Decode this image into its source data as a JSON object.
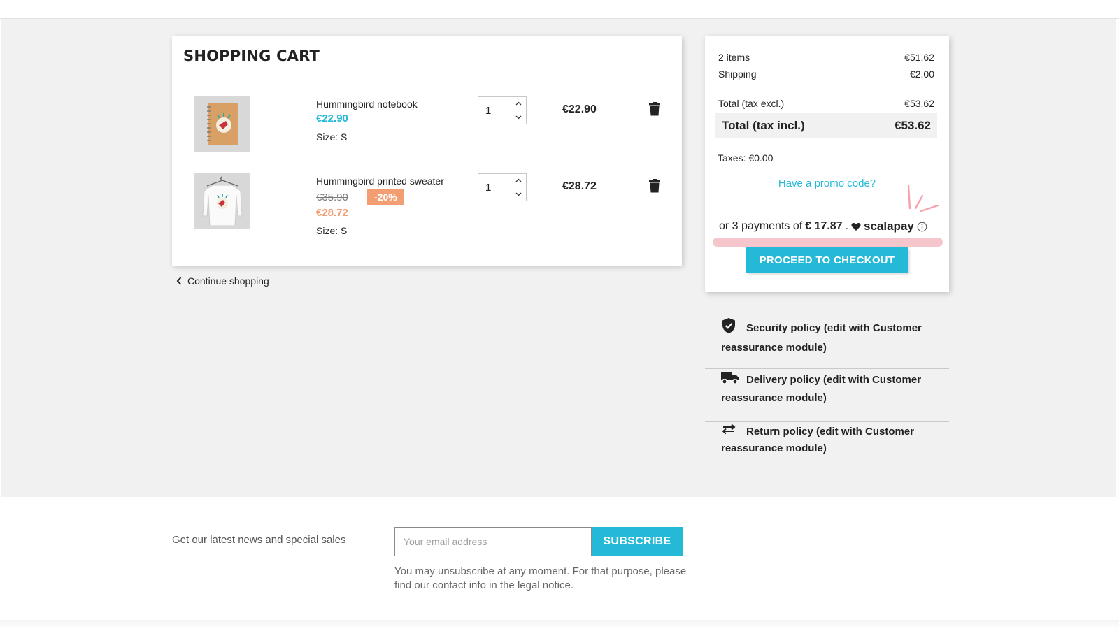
{
  "cart": {
    "title": "SHOPPING CART",
    "items": [
      {
        "name": "Hummingbird notebook",
        "price": "€22.90",
        "size": "Size: S",
        "quantity": "1",
        "total": "€22.90",
        "image_icon": "notebook-image"
      },
      {
        "name": "Hummingbird printed sweater",
        "old_price": "€35.90",
        "discount": "-20%",
        "price": "€28.72",
        "size": "Size: S",
        "quantity": "1",
        "total": "€28.72",
        "image_icon": "sweater-image"
      }
    ],
    "continue_label": "Continue shopping"
  },
  "summary": {
    "items_label": "2 items",
    "items_value": "€51.62",
    "shipping_label": "Shipping",
    "shipping_value": "€2.00",
    "total_excl_label": "Total (tax excl.)",
    "total_excl_value": "€53.62",
    "total_incl_label": "Total (tax incl.)",
    "total_incl_value": "€53.62",
    "taxes": "Taxes: €0.00",
    "promo": "Have a promo code?",
    "installments_prefix": "or 3 payments of",
    "installments_amount": "€ 17.87",
    "installments_dot": ".",
    "scalapay_label": "scalapay",
    "checkout_label": "PROCEED TO CHECKOUT"
  },
  "reassurance": [
    {
      "icon": "shield-check-icon",
      "text": "Security policy (edit with Customer reassurance module)"
    },
    {
      "icon": "truck-icon",
      "text": "Delivery policy (edit with Customer reassurance module)"
    },
    {
      "icon": "swap-arrows-icon",
      "text": "Return policy (edit with Customer reassurance module)"
    }
  ],
  "newsletter": {
    "label": "Get our latest news and special sales",
    "placeholder": "Your email address",
    "button": "SUBSCRIBE",
    "note": "You may unsubscribe at any moment. For that purpose, please find our contact info in the legal notice."
  },
  "colors": {
    "accent": "#24b9d7",
    "discount": "#f39d72",
    "scalapay_pink": "#f5c6cc",
    "background": "#f1f1f1"
  }
}
